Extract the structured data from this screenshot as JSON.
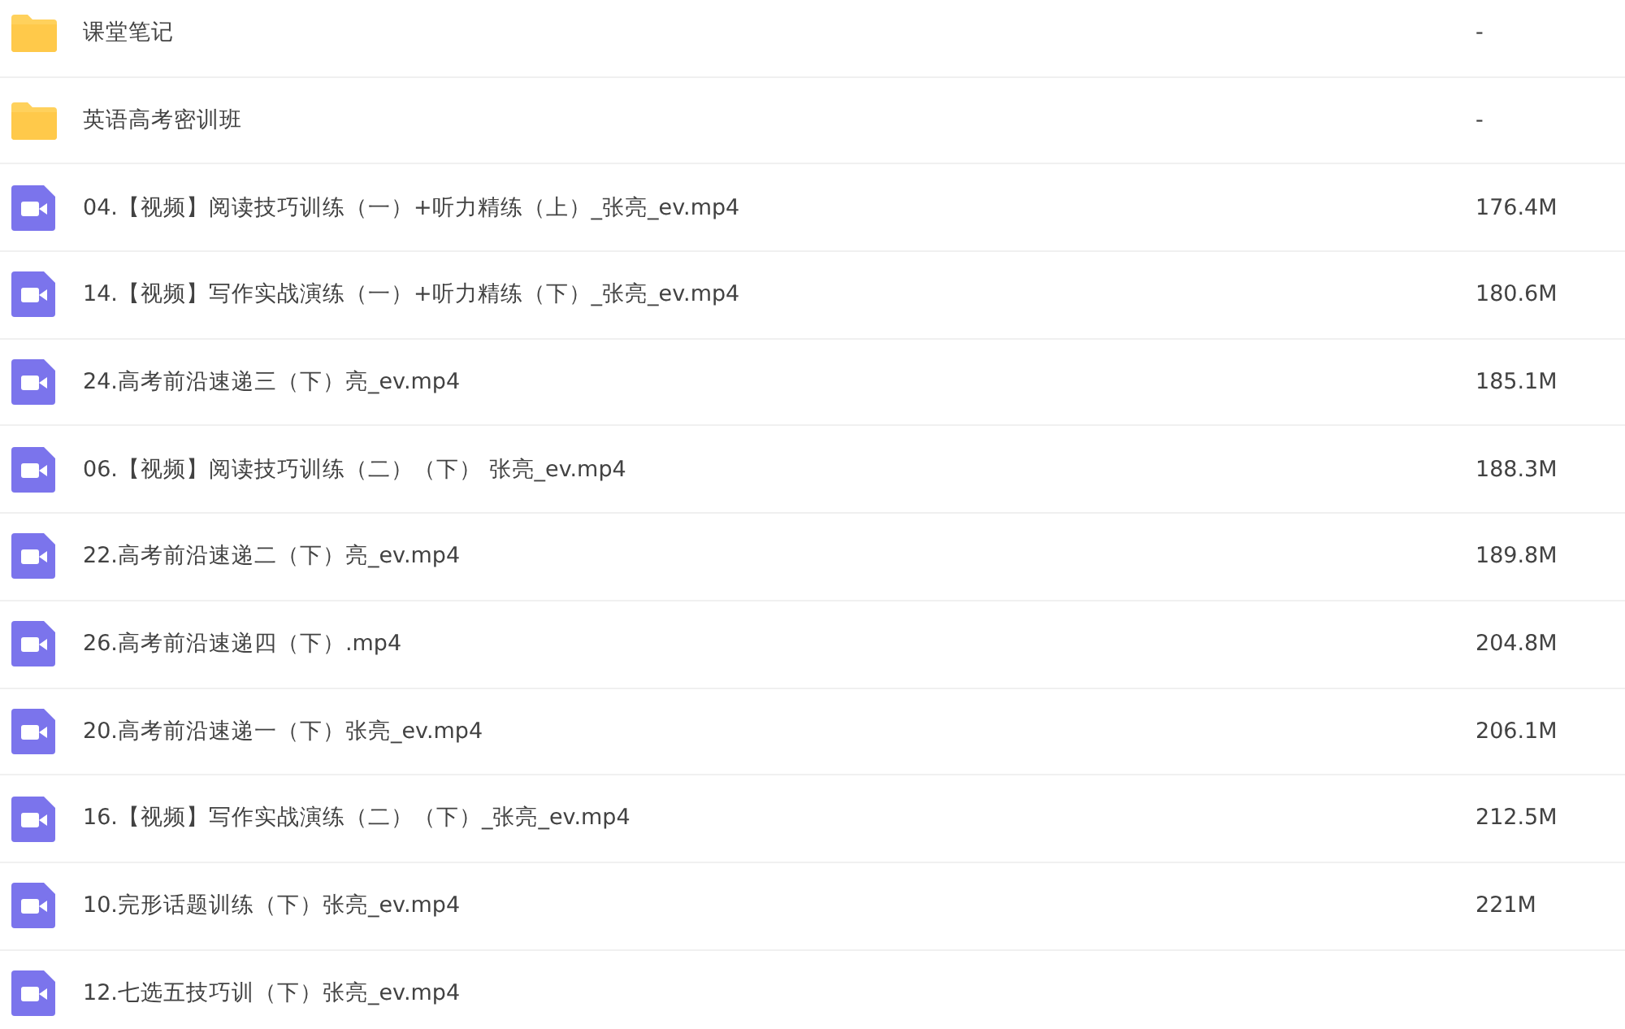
{
  "files": [
    {
      "kind": "folder",
      "name": "课堂笔记",
      "size": "-"
    },
    {
      "kind": "folder",
      "name": "英语高考密训班",
      "size": "-"
    },
    {
      "kind": "video",
      "name": "04.【视频】阅读技巧训练（一）+听力精练（上）_张亮_ev.mp4",
      "size": "176.4M"
    },
    {
      "kind": "video",
      "name": "14.【视频】写作实战演练（一）+听力精练（下）_张亮_ev.mp4",
      "size": "180.6M"
    },
    {
      "kind": "video",
      "name": "24.高考前沿速递三（下）亮_ev.mp4",
      "size": "185.1M"
    },
    {
      "kind": "video",
      "name": "06.【视频】阅读技巧训练（二）（下） 张亮_ev.mp4",
      "size": "188.3M"
    },
    {
      "kind": "video",
      "name": "22.高考前沿速递二（下）亮_ev.mp4",
      "size": "189.8M"
    },
    {
      "kind": "video",
      "name": "26.高考前沿速递四（下）.mp4",
      "size": "204.8M"
    },
    {
      "kind": "video",
      "name": "20.高考前沿速递一（下）张亮_ev.mp4",
      "size": "206.1M"
    },
    {
      "kind": "video",
      "name": "16.【视频】写作实战演练（二）（下）_张亮_ev.mp4",
      "size": "212.5M"
    },
    {
      "kind": "video",
      "name": "10.完形话题训练（下）张亮_ev.mp4",
      "size": "221M"
    },
    {
      "kind": "video",
      "name": "12.七选五技巧训（下）张亮_ev.mp4"
    }
  ]
}
